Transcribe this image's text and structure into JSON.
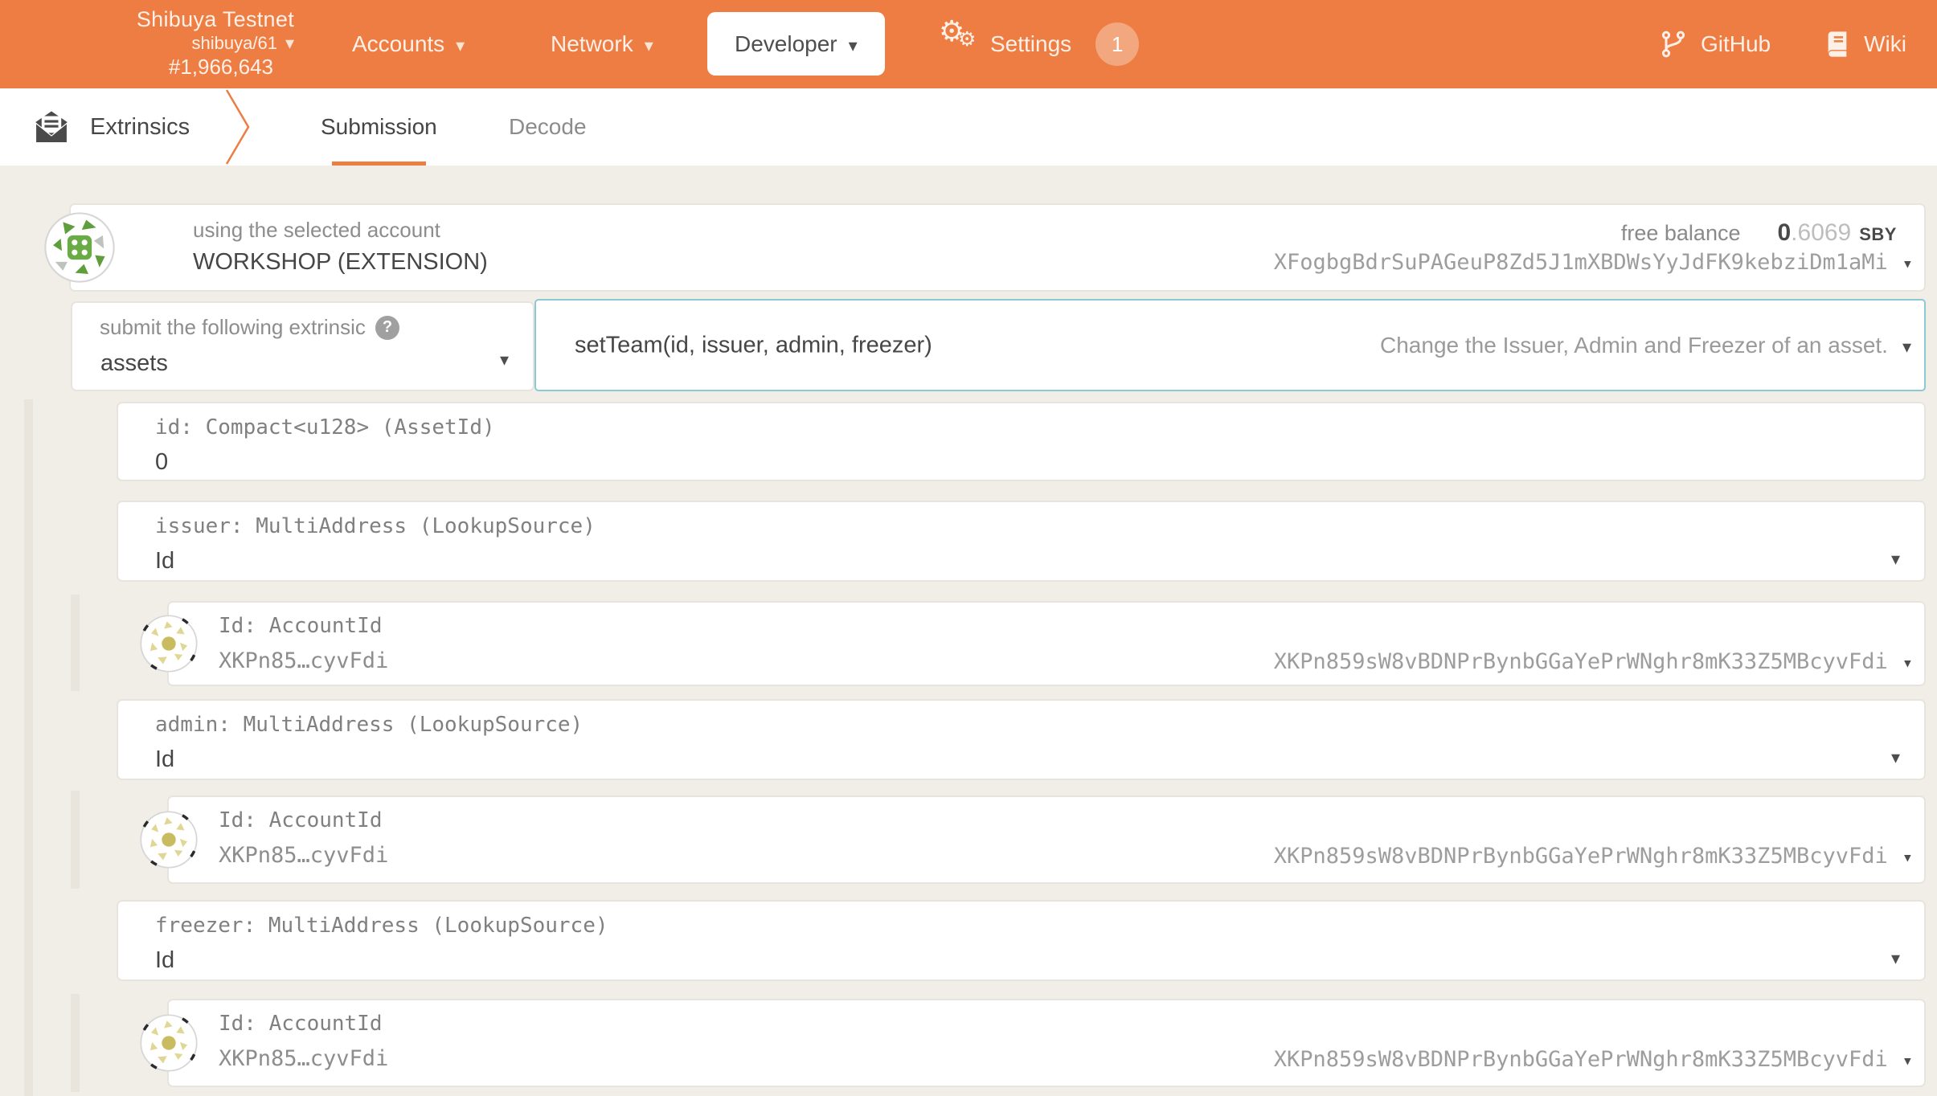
{
  "header": {
    "network": {
      "name": "Shibuya Testnet",
      "spec": "shibuya/61",
      "block": "#1,966,643"
    },
    "nav": {
      "accounts": "Accounts",
      "network": "Network",
      "developer": "Developer",
      "settings": "Settings",
      "settings_badge": "1"
    },
    "links": {
      "github": "GitHub",
      "wiki": "Wiki"
    }
  },
  "tabbar": {
    "section": "Extrinsics",
    "tabs": [
      "Submission",
      "Decode"
    ]
  },
  "account": {
    "label": "using the selected account",
    "name": "WORKSHOP (EXTENSION)",
    "balance_label": "free balance",
    "balance_whole": "0",
    "balance_frac": ".6069",
    "balance_unit": "SBY",
    "address": "XFogbgBdrSuPAGeuP8Zd5J1mXBDWsYyJdFK9kebziDm1aMi"
  },
  "extrinsic": {
    "label": "submit the following extrinsic",
    "pallet": "assets",
    "method": "setTeam(id, issuer, admin, freezer)",
    "description": "Change the Issuer, Admin and Freezer of an asset."
  },
  "params": [
    {
      "label": "id: Compact<u128> (AssetId)",
      "value": "0"
    },
    {
      "label": "issuer: MultiAddress (LookupSource)",
      "value": "Id",
      "child": {
        "label": "Id: AccountId",
        "short": "XKPn85…cyvFdi",
        "address": "XKPn859sW8vBDNPrBynbGGaYePrWNghr8mK33Z5MBcyvFdi"
      }
    },
    {
      "label": "admin: MultiAddress (LookupSource)",
      "value": "Id",
      "child": {
        "label": "Id: AccountId",
        "short": "XKPn85…cyvFdi",
        "address": "XKPn859sW8vBDNPrBynbGGaYePrWNghr8mK33Z5MBcyvFdi"
      }
    },
    {
      "label": "freezer: MultiAddress (LookupSource)",
      "value": "Id",
      "child": {
        "label": "Id: AccountId",
        "short": "XKPn85…cyvFdi",
        "address": "XKPn859sW8vBDNPrBynbGGaYePrWNghr8mK33Z5MBcyvFdi"
      }
    }
  ],
  "icons": {
    "caret": "▾",
    "help": "?",
    "settings": "double-gear",
    "github": "code-branch",
    "wiki": "book",
    "extrinsics": "envelope-open"
  },
  "colors": {
    "topbar": "#ed7d43",
    "accent": "#ed7d43",
    "focus_border": "#8cc9d5",
    "badge": "#f3a77e",
    "page_bg": "#f1ede7"
  }
}
